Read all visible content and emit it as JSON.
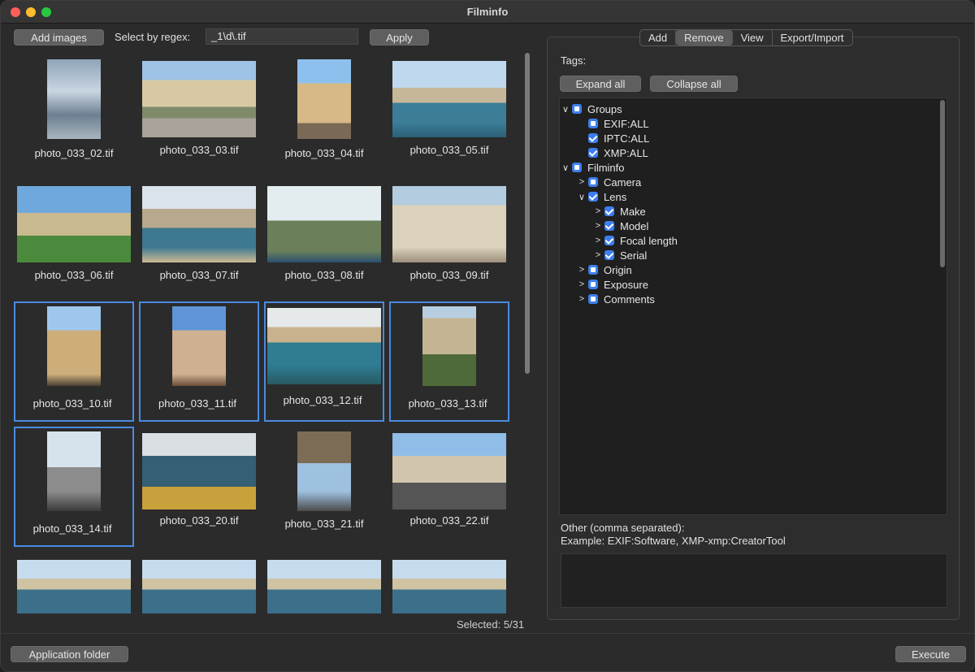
{
  "window": {
    "title": "Filminfo"
  },
  "toolbar": {
    "add_images": "Add images",
    "select_regex_label": "Select by regex:",
    "regex_value": "_1\\d\\.tif",
    "apply": "Apply"
  },
  "gallery": {
    "items": [
      {
        "name": "photo_033_02.tif",
        "selected": false
      },
      {
        "name": "photo_033_03.tif",
        "selected": false
      },
      {
        "name": "photo_033_04.tif",
        "selected": false
      },
      {
        "name": "photo_033_05.tif",
        "selected": false
      },
      {
        "name": "photo_033_06.tif",
        "selected": false
      },
      {
        "name": "photo_033_07.tif",
        "selected": false
      },
      {
        "name": "photo_033_08.tif",
        "selected": false
      },
      {
        "name": "photo_033_09.tif",
        "selected": false
      },
      {
        "name": "photo_033_10.tif",
        "selected": true
      },
      {
        "name": "photo_033_11.tif",
        "selected": true
      },
      {
        "name": "photo_033_12.tif",
        "selected": true
      },
      {
        "name": "photo_033_13.tif",
        "selected": true
      },
      {
        "name": "photo_033_14.tif",
        "selected": true
      },
      {
        "name": "photo_033_20.tif",
        "selected": false
      },
      {
        "name": "photo_033_21.tif",
        "selected": false
      },
      {
        "name": "photo_033_22.tif",
        "selected": false
      }
    ],
    "selected_count": "Selected: 5/31"
  },
  "tabs": [
    "Add",
    "Remove",
    "View",
    "Export/Import"
  ],
  "active_tab": "Remove",
  "tags": {
    "label": "Tags:",
    "expand_all": "Expand all",
    "collapse_all": "Collapse all",
    "tree": [
      {
        "label": "Groups",
        "level": 0,
        "chevron": "down",
        "check": "partial"
      },
      {
        "label": "EXIF:ALL",
        "level": 1,
        "chevron": "none",
        "check": "partial"
      },
      {
        "label": "IPTC:ALL",
        "level": 1,
        "chevron": "none",
        "check": "checked"
      },
      {
        "label": "XMP:ALL",
        "level": 1,
        "chevron": "none",
        "check": "checked"
      },
      {
        "label": "Filminfo",
        "level": 0,
        "chevron": "down",
        "check": "partial"
      },
      {
        "label": "Camera",
        "level": 1,
        "chevron": "right",
        "check": "partial"
      },
      {
        "label": "Lens",
        "level": 1,
        "chevron": "down",
        "check": "checked"
      },
      {
        "label": "Make",
        "level": 2,
        "chevron": "right",
        "check": "checked"
      },
      {
        "label": "Model",
        "level": 2,
        "chevron": "right",
        "check": "checked"
      },
      {
        "label": "Focal length",
        "level": 2,
        "chevron": "right",
        "check": "checked"
      },
      {
        "label": "Serial",
        "level": 2,
        "chevron": "right",
        "check": "checked"
      },
      {
        "label": "Origin",
        "level": 1,
        "chevron": "right",
        "check": "partial"
      },
      {
        "label": "Exposure",
        "level": 1,
        "chevron": "right",
        "check": "partial"
      },
      {
        "label": "Comments",
        "level": 1,
        "chevron": "right",
        "check": "partial"
      }
    ]
  },
  "other": {
    "label": "Other (comma separated):",
    "example": "Example: EXIF:Software, XMP-xmp:CreatorTool",
    "value": ""
  },
  "footer": {
    "application_folder": "Application folder",
    "execute": "Execute"
  },
  "colors": {
    "accent": "#4a8be0",
    "checkbox": "#3d7ef0"
  }
}
